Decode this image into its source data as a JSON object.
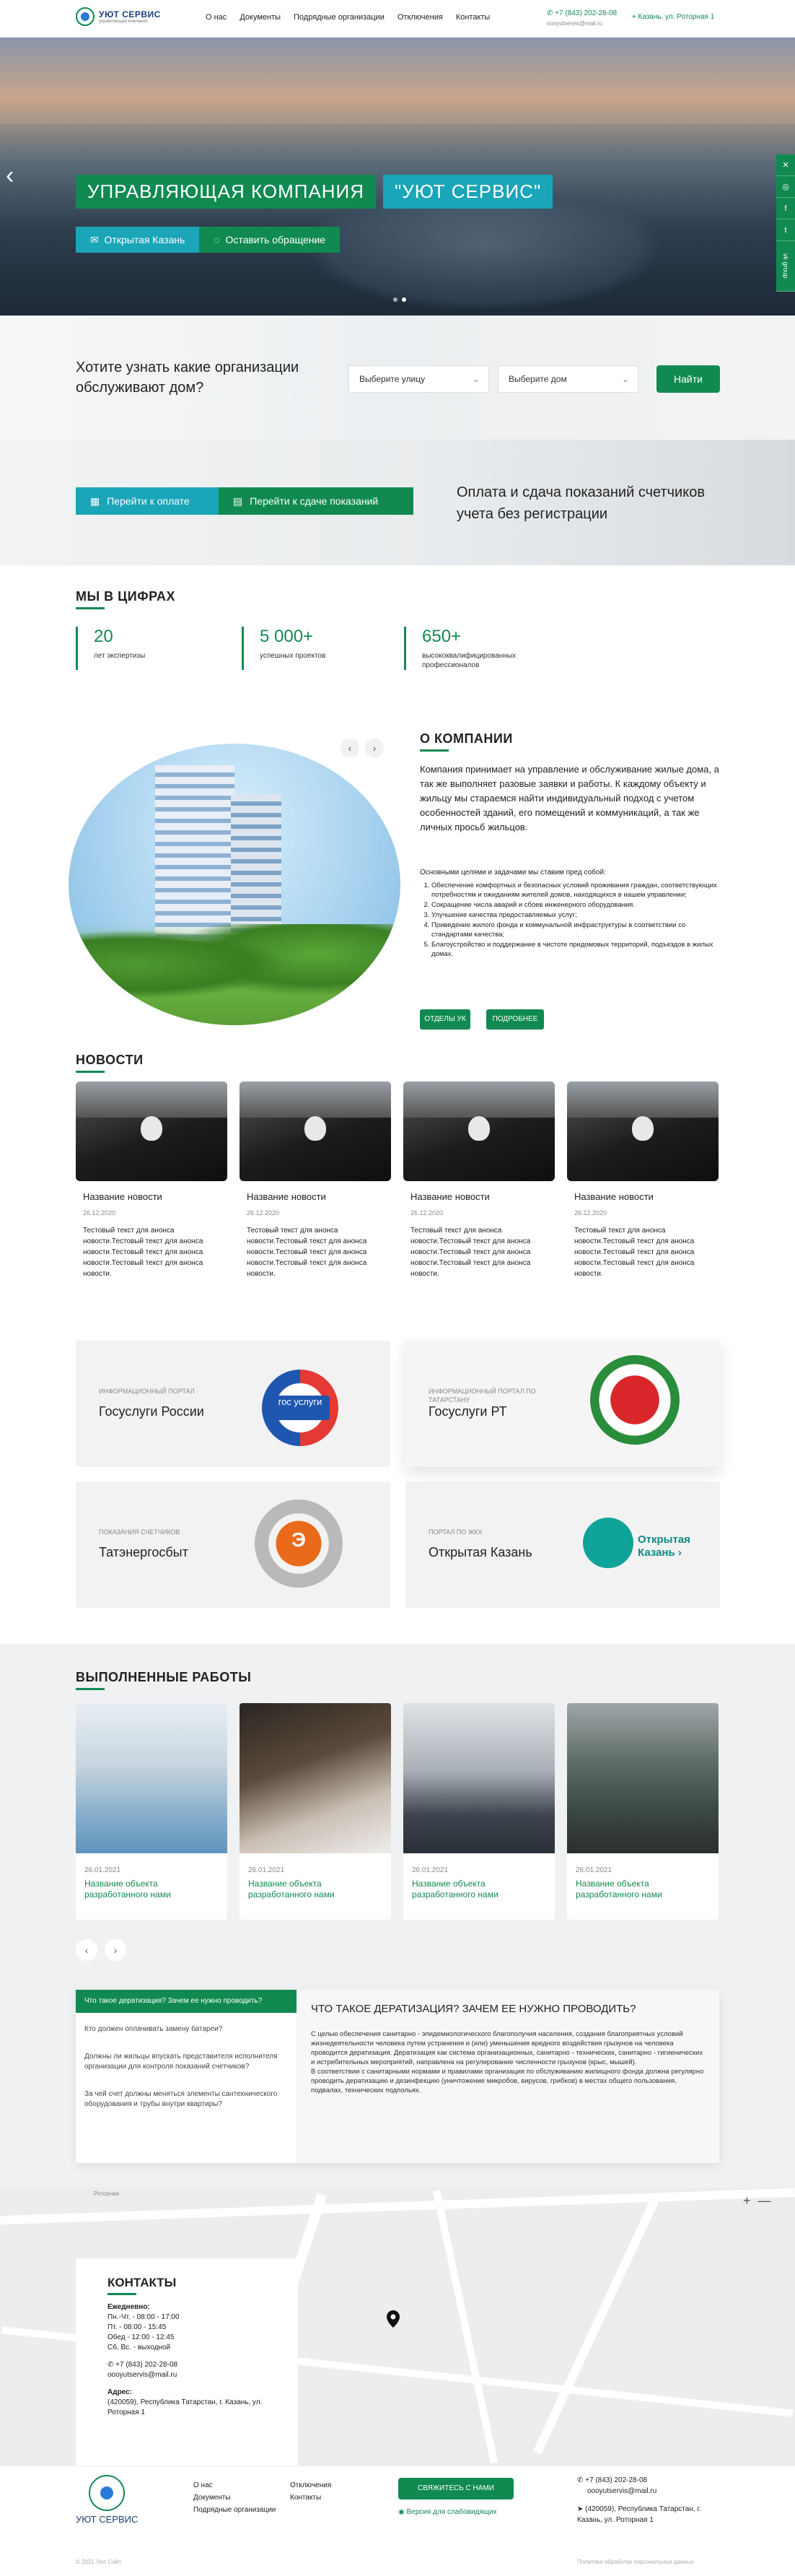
{
  "header": {
    "logo_title": "УЮТ СЕРВИС",
    "logo_sub": "управляющая компания",
    "nav": [
      "О нас",
      "Документы",
      "Подрядные организации",
      "Отключения",
      "Контакты"
    ],
    "phone": "+7 (843) 202-28-08",
    "email": "oooyutservis@mail.ru",
    "address": "Казань, ул. Роторная 1"
  },
  "hero": {
    "title_a": "УПРАВЛЯЮЩАЯ КОМПАНИЯ",
    "title_b": "\"УЮТ СЕРВИС\"",
    "btn_open": "Открытая Казань",
    "btn_appeal": "Оставить обращение",
    "prev_arrow": "‹",
    "social_vk": "vk group"
  },
  "find": {
    "question": "Хотите узнать какие организации обслуживают дом?",
    "street_placeholder": "Выберите улицу",
    "house_placeholder": "Выберите дом",
    "btn": "Найти"
  },
  "pay": {
    "btn_pay": "Перейти к оплате",
    "btn_meters": "Перейти к сдаче показаний",
    "text": "Оплата и сдача показаний счетчиков учета без регистрации"
  },
  "numbers": {
    "title": "МЫ В ЦИФРАХ",
    "items": [
      {
        "value": "20",
        "desc": "лет экспертизы"
      },
      {
        "value": "5 000+",
        "desc": "успешных проектов"
      },
      {
        "value": "650+",
        "desc": "высококвалифицированных профессионалов"
      }
    ]
  },
  "about": {
    "title": "О КОМПАНИИ",
    "lead": "Компания принимает на управление и обслуживание жилые дома, а так же выполняет разовые заявки и работы. К каждому объекту и жильцу мы стараемся найти индивидуальный подход с учетом особенностей зданий, его помещений и коммуникаций, а так же личных просьб жильцов.",
    "sub": "Основными целями и задачами мы ставим пред собой:",
    "list": [
      "Обеспечение комфортных и безопасных условий проживания граждан, соответствующих потребностям и ожиданиям жителей домов, находящихся в нашем управлении;",
      "Сокращение числа аварий и сбоев инженерного оборудования.",
      "Улучшение качества предоставляемых услуг;",
      "Приведение жилого фонда и коммунальной инфраструктуры в соответствии со стандартами качества;",
      "Благоустройство и поддержание в чистоте придомовых территорий, подъездов в жилых домах."
    ],
    "btn_departments": "ОТДЕЛЫ УК",
    "btn_more": "ПОДРОБНЕЕ"
  },
  "news": {
    "title": "НОВОСТИ",
    "items": [
      {
        "title": "Название новости",
        "date": "26.12.2020",
        "text": "Тестовый текст для анонса новости.Тестовый текст для анонса новости.Тестовый текст для анонса новости.Тестовый текст для анонса новости."
      },
      {
        "title": "Название новости",
        "date": "26.12.2020",
        "text": "Тестовый текст для анонса новости.Тестовый текст для анонса новости.Тестовый текст для анонса новости.Тестовый текст для анонса новости."
      },
      {
        "title": "Название новости",
        "date": "26.12.2020",
        "text": "Тестовый текст для анонса новости.Тестовый текст для анонса новости.Тестовый текст для анонса новости.Тестовый текст для анонса новости."
      },
      {
        "title": "Название новости",
        "date": "26.12.2020",
        "text": "Тестовый текст для анонса новости.Тестовый текст для анонса новости.Тестовый текст для анонса новости.Тестовый текст для анонса новости."
      }
    ]
  },
  "portals": [
    {
      "label": "ИНФОРМАЦИОННЫЙ ПОРТАЛ",
      "name": "Госуслуги России",
      "logo_text": "гос услуги"
    },
    {
      "label": "ИНФОРМАЦИОННЫЙ ПОРТАЛ ПО ТАТАРСТАНУ",
      "name": "Госуслуги РТ",
      "logo_text": ""
    },
    {
      "label": "ПОКАЗАНИЯ СЧЕТЧИКОВ",
      "name": "Татэнергосбыт",
      "logo_text": "Э"
    },
    {
      "label": "ПОРТАЛ ПО ЖКХ",
      "name": "Открытая Казань",
      "logo_text": "Открытая Казань ›"
    }
  ],
  "works": {
    "title": "ВЫПОЛНЕННЫЕ РАБОТЫ",
    "items": [
      {
        "date": "26.01.2021",
        "title": "Название объекта разработанного нами"
      },
      {
        "date": "26.01.2021",
        "title": "Название объекта разработанного нами"
      },
      {
        "date": "26.01.2021",
        "title": "Название объекта разработанного нами"
      },
      {
        "date": "26.01.2021",
        "title": "Название объекта разработанного нами"
      }
    ],
    "prev": "‹",
    "next": "›"
  },
  "faq": {
    "active_tab": "Что такое дератизация? Зачем ее нужно проводить?",
    "questions": [
      "Кто должен оплачивать замену батареи?",
      "Должны ли жильцы впускать представителя исполнителя организации для контроля показаний счетчиков?",
      "За чей счет должны меняться элементы сантехнического оборудования и трубы внутри квартиры?"
    ],
    "answer_title": "ЧТО ТАКОЕ ДЕРАТИЗАЦИЯ? ЗАЧЕМ ЕЕ НУЖНО ПРОВОДИТЬ?",
    "answer_p1": "С целью обеспечения санитарно - эпидемиологического благополучия населения, создания благоприятных условий жизнедеятельности человека путем устранения и (или) уменьшения вредного воздействия грызунов на человека проводится дератизация. Дератизация как система организационных, санитарно - технических, санитарно - гигиенических и истребительных мероприятий, направлена на регулирование численности грызунов (крыс, мышей).",
    "answer_p2": "В соответствии с санитарными нормами и правилами организация по обслуживанию жилищного фонда должна регулярно проводить дератизацию и дезинфекцию (уничтожение микробов, вирусов, грибков) в местах общего пользования, подвалах, технических подпольях."
  },
  "map": {
    "zoom_in": "+",
    "zoom_out": "—",
    "street_label": "Роторная",
    "contacts_title": "КОНТАКТЫ",
    "schedule_title": "Ежедневно:",
    "schedule": [
      "Пн.-Чт. - 08:00 - 17:00",
      "Пт. - 08:00 - 15:45",
      "Обед - 12:00 - 12:45",
      "Сб, Вс. - выходной"
    ],
    "phone": "+7 (843) 202-28-08",
    "email": "oooyutservis@mail.ru",
    "addr_title": "Адрес:",
    "address": "(420059), Республика Татарстан, г. Казань, ул. Роторная 1"
  },
  "footer": {
    "logo_title": "УЮТ СЕРВИС",
    "col1": [
      "О нас",
      "Документы",
      "Подрядные организации"
    ],
    "col2": [
      "Отключения",
      "Контакты"
    ],
    "btn_contact": "СВЯЖИТЕСЬ С НАМИ",
    "weak_version": "Версия для слабовидящих",
    "phone": "+7 (843) 202-28-08",
    "email": "oooyutservis@mail.ru",
    "address": "(420059), Республика Татарстан, г. Казань, ул. Роторная 1",
    "copyright": "© 2021 Уют Сайт",
    "policy": "Политика обработки персональных данных"
  }
}
